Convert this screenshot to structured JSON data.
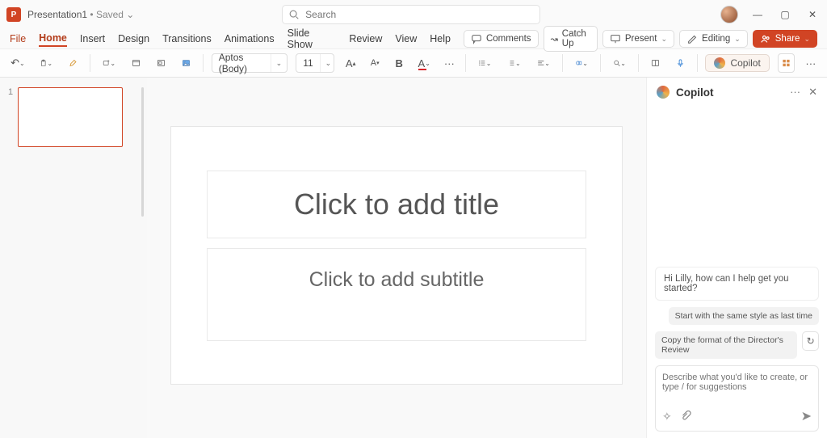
{
  "title": {
    "document_name": "Presentation1",
    "save_status": "• Saved  ⌄",
    "search_placeholder": "Search"
  },
  "menu": {
    "items": [
      "File",
      "Home",
      "Insert",
      "Design",
      "Transitions",
      "Animations",
      "Slide Show",
      "Review",
      "View",
      "Help"
    ],
    "active_index": 1
  },
  "command_bar": {
    "comments": "Comments",
    "catchup": "Catch Up",
    "present": "Present",
    "editing": "Editing",
    "share": "Share"
  },
  "ribbon": {
    "font_name": "Aptos (Body)",
    "font_size": "11",
    "bold": "B",
    "copilot_label": "Copilot"
  },
  "slides": {
    "thumbs": [
      {
        "number": "1"
      }
    ]
  },
  "canvas": {
    "title_ph": "Click to add title",
    "subtitle_ph": "Click to add subtitle"
  },
  "copilot": {
    "title": "Copilot",
    "greeting": "Hi Lilly, how can I help get you started?",
    "suggestion1": "Start with the same style as last time",
    "suggestion2": "Copy the format of the Director's Review",
    "input_placeholder": "Describe what you'd like to create, or type / for suggestions"
  }
}
